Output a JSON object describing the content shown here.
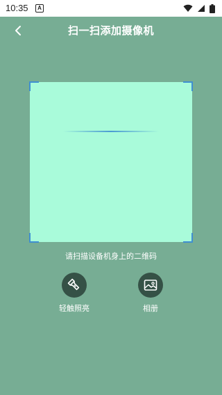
{
  "status_bar": {
    "time": "10:35",
    "notification_icon": "a-box-icon",
    "right_icons": [
      "wifi-icon",
      "signal-icon",
      "battery-icon"
    ]
  },
  "header": {
    "title": "扫一扫添加摄像机",
    "back_icon": "chevron-left-icon"
  },
  "scanner": {
    "hint": "请扫描设备机身上的二维码"
  },
  "actions": {
    "flashlight": {
      "label": "轻触照亮",
      "icon": "flashlight-icon"
    },
    "album": {
      "label": "相册",
      "icon": "image-icon"
    }
  },
  "colors": {
    "background": "#77ad94",
    "scan_area": "#a9fbda",
    "corner_accent": "#3f8fd1",
    "action_circle": "#355146"
  }
}
